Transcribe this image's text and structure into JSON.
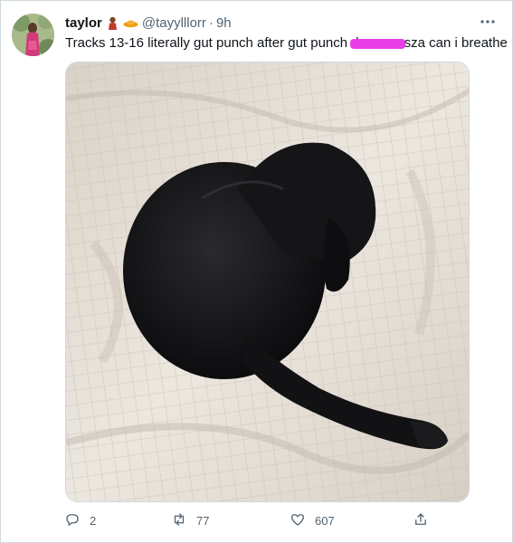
{
  "tweet": {
    "author_name": "taylor",
    "handle": "@tayylllorr",
    "separator": "·",
    "time": "9h",
    "text_before": "Tracks 13-16 literally gut punch after gut punch ",
    "text_redacted": "d",
    "text_after": "sza can i breathe"
  },
  "actions": {
    "reply_count": "2",
    "retweet_count": "77",
    "like_count": "607"
  },
  "icons": {
    "author_emoji_1": "woman-emoji",
    "author_emoji_2": "orange-flying-saucer-emoji",
    "more": "more-dots-icon",
    "reply": "reply-icon",
    "retweet": "retweet-icon",
    "like": "heart-icon",
    "share": "share-icon"
  },
  "colors": {
    "text_primary": "#0f1419",
    "text_secondary": "#536471",
    "redaction": "#e83ee8",
    "border": "#cfd9de"
  }
}
